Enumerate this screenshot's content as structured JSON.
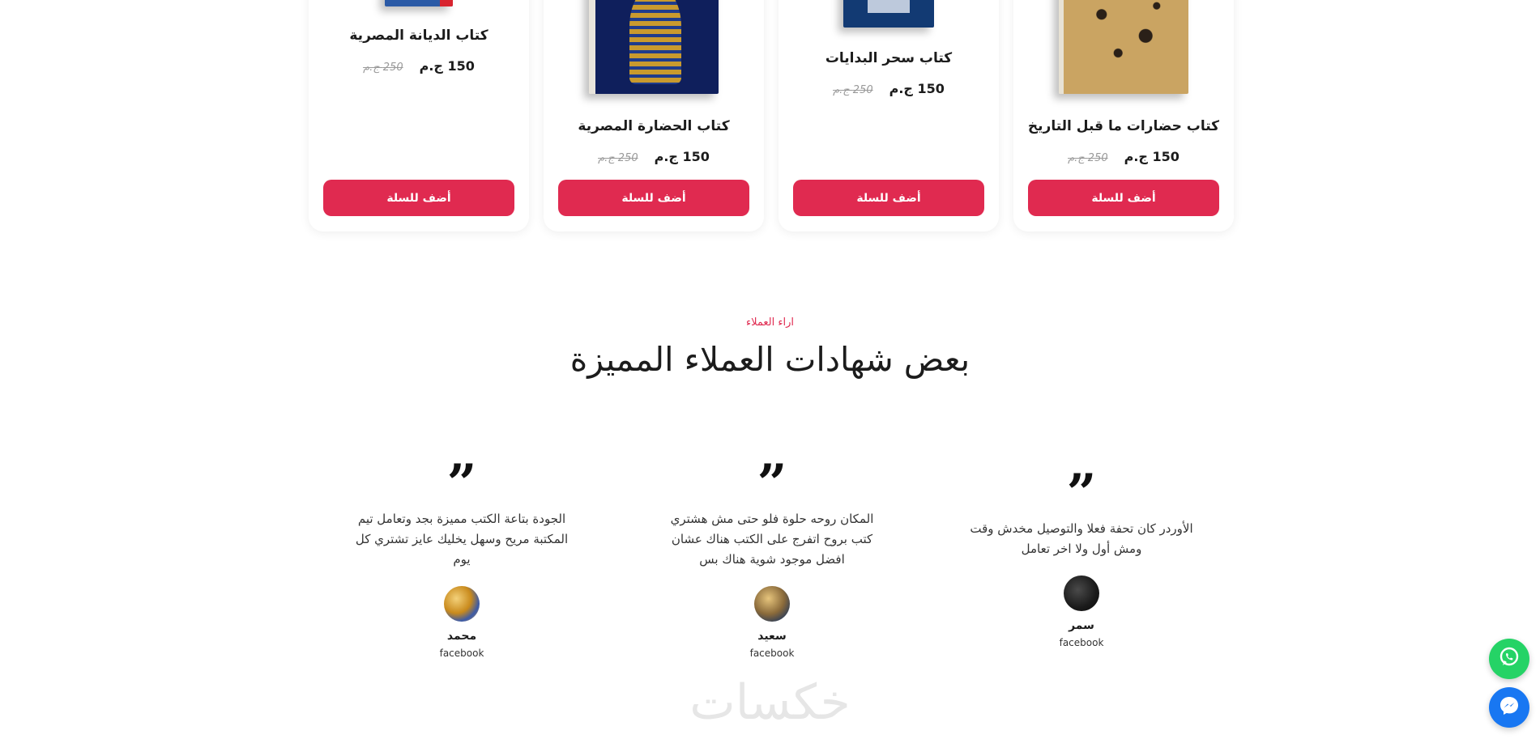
{
  "colors": {
    "accent": "#e02a50",
    "whatsapp": "#25d366",
    "messenger": "#1877f2"
  },
  "products": [
    {
      "title": "كتاب حضارات ما قبل التاريخ",
      "price": "150 ج.م",
      "old_price": "250 ج.م",
      "button": "أضف للسلة"
    },
    {
      "title": "كتاب سحر البدايات",
      "price": "150 ج.م",
      "old_price": "250 ج.م",
      "button": "أضف للسلة"
    },
    {
      "title": "كتاب الحضارة المصرية",
      "price": "150 ج.م",
      "old_price": "250 ج.م",
      "button": "أضف للسلة"
    },
    {
      "title": "كتاب الديانة المصرية",
      "price": "150 ج.م",
      "old_price": "250 ج.م",
      "button": "أضف للسلة"
    }
  ],
  "testimonials_section": {
    "eyebrow": "اراء العملاء",
    "heading": "بعض شهادات العملاء المميزة"
  },
  "testimonials": [
    {
      "quote": "الجودة بتاعة الكتب مميزة بجد وتعامل تيم المكتبة مريح وسهل يخليك عايز تشتري كل يوم",
      "name": "محمد",
      "source": "facebook"
    },
    {
      "quote": "المكان روحه حلوة فلو حتى مش هشتري كتب بروح اتفرج على الكتب هناك عشان افضل موجود شوية هناك بس",
      "name": "سعيد",
      "source": "facebook"
    },
    {
      "quote": "الأوردر كان تحفة فعلا والتوصيل مخدش وقت ومش أول ولا اخر تعامل",
      "name": "سمر",
      "source": "facebook"
    }
  ],
  "watermark": "خكسات",
  "floating": {
    "whatsapp_icon": "whatsapp-icon",
    "messenger_icon": "messenger-icon"
  }
}
